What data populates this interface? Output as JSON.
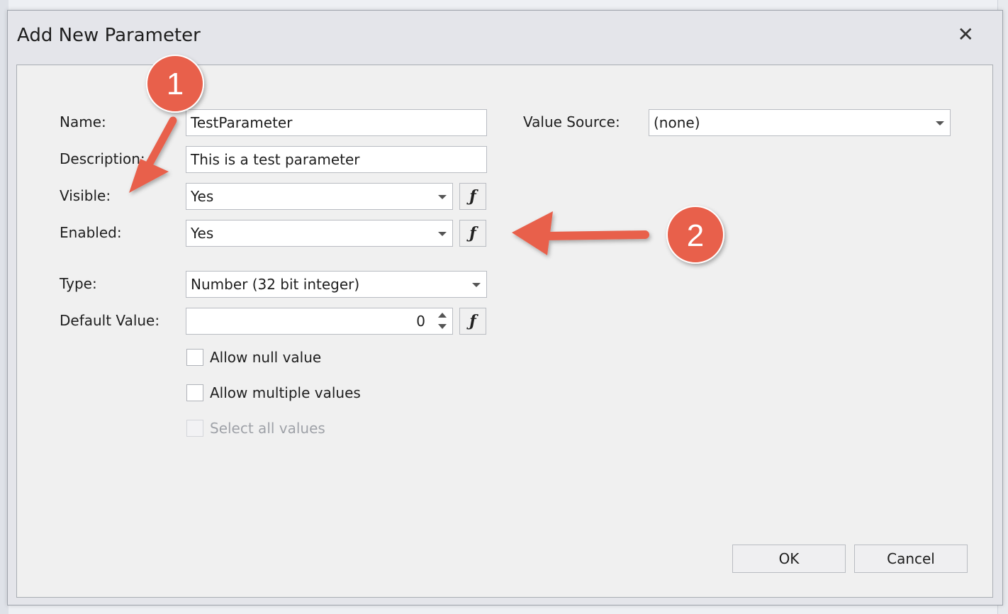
{
  "dialog": {
    "title": "Add New Parameter",
    "close_icon": "close-icon"
  },
  "form": {
    "name_label": "Name:",
    "name_value": "TestParameter",
    "description_label": "Description:",
    "description_value": "This is a test parameter",
    "visible_label": "Visible:",
    "visible_value": "Yes",
    "enabled_label": "Enabled:",
    "enabled_value": "Yes",
    "type_label": "Type:",
    "type_value": "Number (32 bit integer)",
    "default_label": "Default Value:",
    "default_value": "0",
    "value_source_label": "Value Source:",
    "value_source_value": "(none)",
    "expression_button_glyph": "ƒ"
  },
  "options": {
    "allow_null": "Allow null value",
    "allow_multiple": "Allow multiple values",
    "select_all": "Select all values"
  },
  "buttons": {
    "ok": "OK",
    "cancel": "Cancel"
  },
  "annotations": {
    "badge_1": "1",
    "badge_2": "2",
    "color": "#e8604c"
  }
}
